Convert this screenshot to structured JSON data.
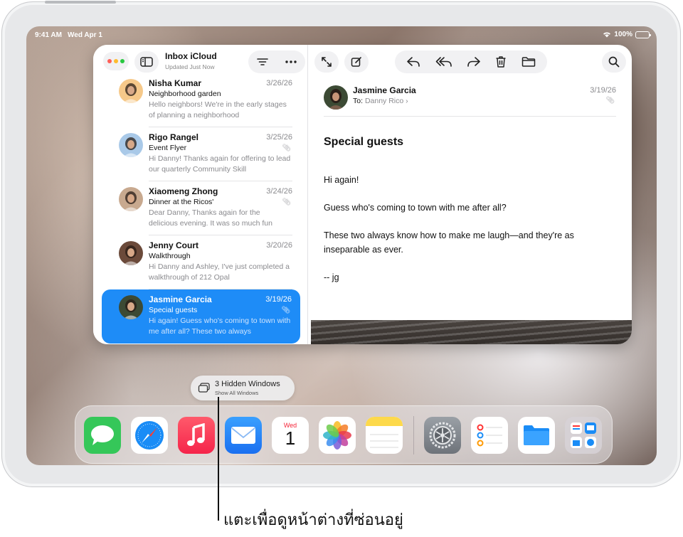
{
  "status_bar": {
    "time": "9:41 AM",
    "date": "Wed Apr 1",
    "app": "Mail",
    "battery": "100%",
    "battery_level": 1.0
  },
  "mailbox": {
    "title": "Inbox iCloud",
    "subtitle": "Updated Just Now"
  },
  "messages": [
    {
      "from": "Nisha Kumar",
      "date": "3/26/26",
      "subject": "Neighborhood garden",
      "preview": "Hello neighbors! We're in the early stages of planning a neighborhood",
      "attachment": false,
      "selected": false,
      "avatar_color": "#f6c98a"
    },
    {
      "from": "Rigo Rangel",
      "date": "3/25/26",
      "subject": "Event Flyer",
      "preview": "Hi Danny! Thanks again for offering to lead our quarterly Community Skill",
      "attachment": true,
      "selected": false,
      "avatar_color": "#a9c9e8"
    },
    {
      "from": "Xiaomeng Zhong",
      "date": "3/24/26",
      "subject": "Dinner at the Ricos'",
      "preview": "Dear Danny, Thanks again for the delicious evening. It was so much fun",
      "attachment": true,
      "selected": false,
      "avatar_color": "#c8a98f"
    },
    {
      "from": "Jenny Court",
      "date": "3/20/26",
      "subject": "Walkthrough",
      "preview": "Hi Danny and Ashley, I've just completed a walkthrough of 212 Opal",
      "attachment": false,
      "selected": false,
      "avatar_color": "#6b4a3a"
    },
    {
      "from": "Jasmine Garcia",
      "date": "3/19/26",
      "subject": "Special guests",
      "preview": "Hi again! Guess who's coming to town with me after all? These two always",
      "attachment": true,
      "selected": true,
      "avatar_color": "#3c4a34"
    }
  ],
  "reader": {
    "from": "Jasmine Garcia",
    "to_label": "To:",
    "to_name": "Danny Rico",
    "date": "3/19/26",
    "subject": "Special guests",
    "body": [
      "Hi again!",
      "Guess who's coming to town with me after all?",
      "These two always know how to make me laugh—and they're as inseparable as ever.",
      "-- jg"
    ]
  },
  "hidden_windows": {
    "title": "3 Hidden Windows",
    "subtitle": "Show All Windows"
  },
  "dock": {
    "apps": [
      "messages-icon",
      "safari-icon",
      "music-icon",
      "mail-icon",
      "calendar-icon",
      "photos-icon",
      "notes-icon",
      "settings-icon",
      "reminders-icon",
      "files-icon",
      "app-library-icon"
    ],
    "calendar_day": "Wed",
    "calendar_date": "1"
  },
  "callout": "แตะเพื่อดูหน้าต่างที่ซ่อนอยู่",
  "colors": {
    "accent": "#1e8cf7"
  }
}
